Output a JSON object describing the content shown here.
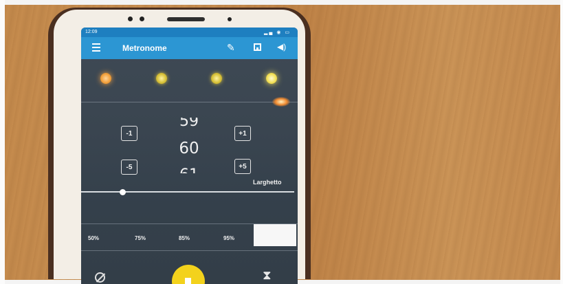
{
  "status_bar": {
    "time": "12:09",
    "icons": "▂▄ ◉ ▭"
  },
  "app_bar": {
    "title": "Metronome",
    "pencil_glyph": "✎",
    "volume_glyph": "◀)"
  },
  "beats": [
    {
      "color": "orange"
    },
    {
      "color": "yellow"
    },
    {
      "color": "yellow"
    },
    {
      "color": "bright-yellow"
    }
  ],
  "tempo": {
    "minus_one": "-1",
    "plus_one": "+1",
    "minus_five": "-5",
    "plus_five": "+5",
    "previous": "59",
    "current": "60",
    "next": "61",
    "name": "Larghetto",
    "slider_fraction": 0.2
  },
  "percentages": [
    "50%",
    "75%",
    "85%",
    "95%"
  ],
  "controls": {
    "hourglass_glyph": "⧗"
  },
  "colors": {
    "accent": "#2c96d3",
    "play": "#f3d21c",
    "screen_bg": "#3a4550"
  }
}
